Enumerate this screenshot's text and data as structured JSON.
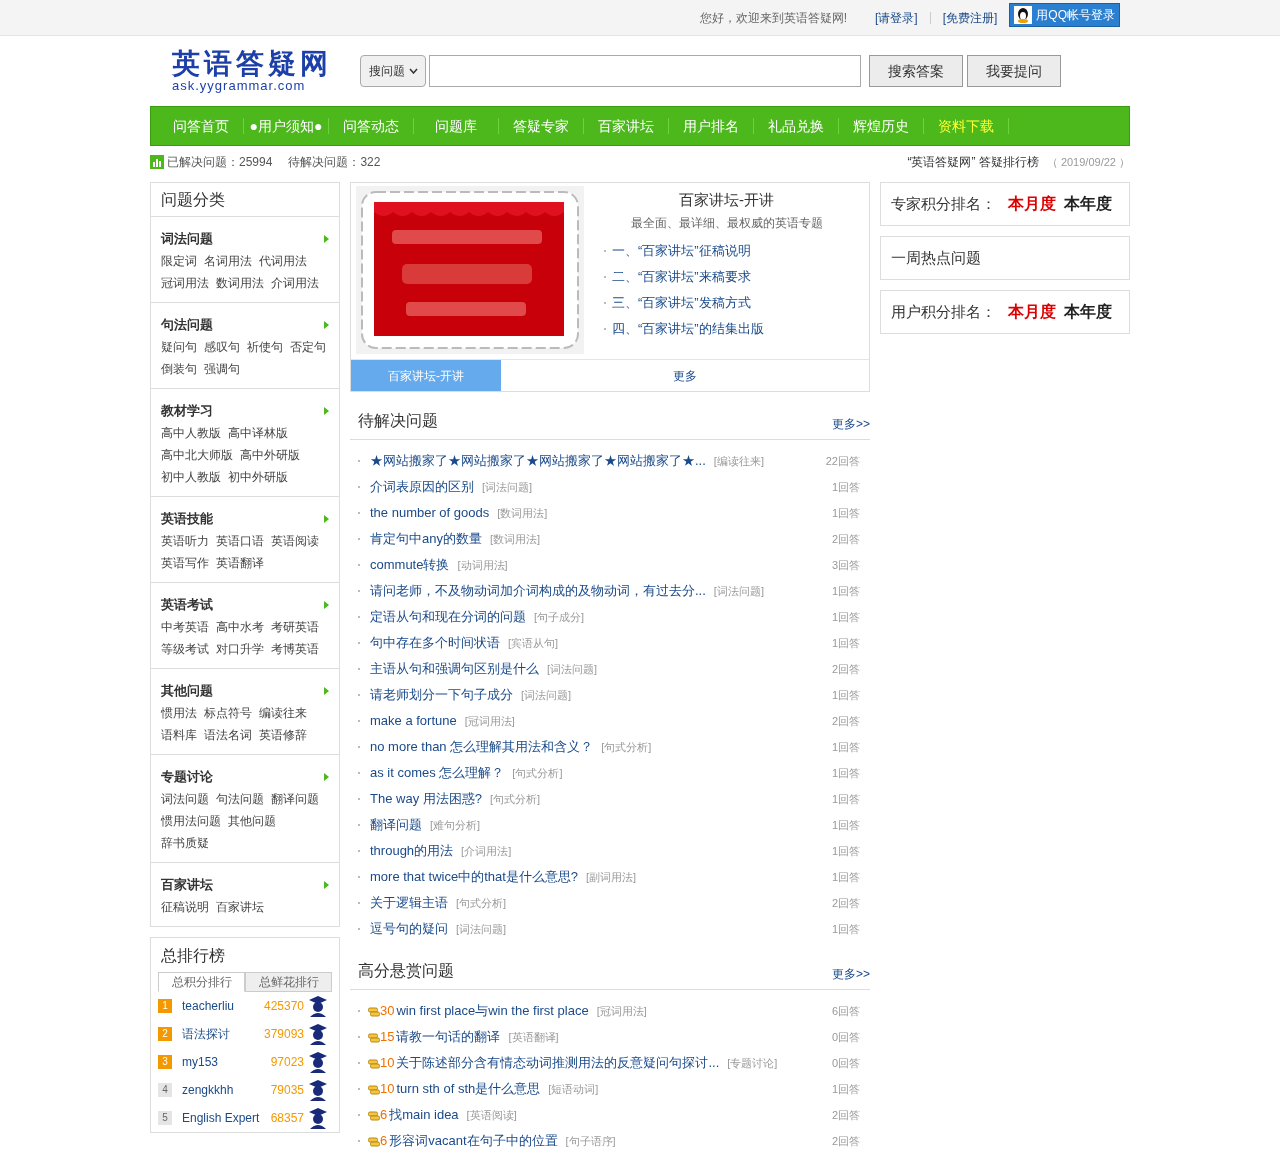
{
  "top_bar": {
    "welcome": "您好，欢迎来到英语答疑网!",
    "login": "[请登录]",
    "register": "[免费注册]",
    "qq_login": "用QQ帐号登录"
  },
  "header": {
    "logo_title": "英语答疑网",
    "logo_url": "ask.yygrammar.com",
    "search_type": "搜问题",
    "search_button": "搜索答案",
    "ask_button": "我要提问"
  },
  "nav": [
    {
      "label": "问答首页",
      "highlight": false
    },
    {
      "label": "●用户须知●",
      "highlight": false
    },
    {
      "label": "问答动态",
      "highlight": false
    },
    {
      "label": "问题库",
      "highlight": false
    },
    {
      "label": "答疑专家",
      "highlight": false
    },
    {
      "label": "百家讲坛",
      "highlight": false
    },
    {
      "label": "用户排名",
      "highlight": false
    },
    {
      "label": "礼品兑换",
      "highlight": false
    },
    {
      "label": "辉煌历史",
      "highlight": false
    },
    {
      "label": "资料下载",
      "highlight": true
    }
  ],
  "stats": {
    "solved": "已解决问题：25994",
    "pending": "待解决问题：322",
    "ranking_title": "“英语答疑网” 答疑排行榜",
    "date": "（ 2019/09/22 ）"
  },
  "categories": {
    "title": "问题分类",
    "sections": [
      {
        "heading": "词法问题",
        "rows": [
          [
            "限定词",
            "名词用法",
            "代词用法"
          ],
          [
            "冠词用法",
            "数词用法",
            "介词用法"
          ]
        ]
      },
      {
        "heading": "句法问题",
        "rows": [
          [
            "疑问句",
            "感叹句",
            "祈使句",
            "否定句"
          ],
          [
            "倒装句",
            "强调句"
          ]
        ]
      },
      {
        "heading": "教材学习",
        "rows": [
          [
            "高中人教版",
            "高中译林版"
          ],
          [
            "高中北大师版",
            "高中外研版"
          ],
          [
            "初中人教版",
            "初中外研版"
          ]
        ]
      },
      {
        "heading": "英语技能",
        "rows": [
          [
            "英语听力",
            "英语口语",
            "英语阅读"
          ],
          [
            "英语写作",
            "英语翻译"
          ]
        ]
      },
      {
        "heading": "英语考试",
        "rows": [
          [
            "中考英语",
            "高中水考",
            "考研英语"
          ],
          [
            "等级考试",
            "对口升学",
            "考博英语"
          ]
        ]
      },
      {
        "heading": "其他问题",
        "rows": [
          [
            "惯用法",
            "标点符号",
            "编读往来"
          ],
          [
            "语料库",
            "语法名词",
            "英语修辞"
          ]
        ]
      },
      {
        "heading": "专题讨论",
        "rows": [
          [
            "词法问题",
            "句法问题",
            "翻译问题"
          ],
          [
            "惯用法问题",
            "其他问题"
          ],
          [
            "辞书质疑"
          ]
        ]
      },
      {
        "heading": "百家讲坛",
        "rows": [
          [
            "征稿说明",
            "百家讲坛"
          ]
        ]
      }
    ]
  },
  "leaderboard": {
    "title": "总排行榜",
    "tabs": [
      {
        "label": "总积分排行",
        "selected": true
      },
      {
        "label": "总鲜花排行",
        "selected": false
      }
    ],
    "rows": [
      {
        "rank": "1",
        "top": true,
        "name": "teacherliu",
        "score": "425370"
      },
      {
        "rank": "2",
        "top": true,
        "name": "语法探讨",
        "score": "379093"
      },
      {
        "rank": "3",
        "top": true,
        "name": "my153",
        "score": "97023"
      },
      {
        "rank": "4",
        "top": false,
        "name": "zengkkhh",
        "score": "79035"
      },
      {
        "rank": "5",
        "top": false,
        "name": "English Expert",
        "score": "68357"
      }
    ]
  },
  "feature": {
    "title": "百家讲坛-开讲",
    "subtitle": "最全面、最详细、最权威的英语专题",
    "links": [
      "一、“百家讲坛”征稿说明",
      "二、“百家讲坛”来稿要求",
      "三、“百家讲坛”发稿方式",
      "四、“百家讲坛”的结集出版"
    ],
    "tabs": [
      {
        "label": "百家讲坛-开讲",
        "selected": true
      },
      {
        "label": "更多",
        "selected": false
      }
    ]
  },
  "pending": {
    "title": "待解决问题",
    "more": "更多>>",
    "rows": [
      {
        "title": "★网站搬家了★网站搬家了★网站搬家了★网站搬家了★...",
        "category": "[编读往来]",
        "answers": "22回答"
      },
      {
        "title": "介词表原因的区别",
        "category": "[词法问题]",
        "answers": "1回答"
      },
      {
        "title": "the number of goods",
        "category": "[数词用法]",
        "answers": "1回答"
      },
      {
        "title": "肯定句中any的数量",
        "category": "[数词用法]",
        "answers": "2回答"
      },
      {
        "title": "commute转换",
        "category": "[动词用法]",
        "answers": "3回答"
      },
      {
        "title": "请问老师，不及物动词加介词构成的及物动词，有过去分...",
        "category": "[词法问题]",
        "answers": "1回答"
      },
      {
        "title": "定语从句和现在分词的问题",
        "category": "[句子成分]",
        "answers": "1回答"
      },
      {
        "title": "句中存在多个时间状语",
        "category": "[宾语从句]",
        "answers": "1回答"
      },
      {
        "title": "主语从句和强调句区别是什么",
        "category": "[词法问题]",
        "answers": "2回答"
      },
      {
        "title": "请老师划分一下句子成分",
        "category": "[词法问题]",
        "answers": "1回答"
      },
      {
        "title": "make a fortune",
        "category": "[冠词用法]",
        "answers": "2回答"
      },
      {
        "title": "no more than 怎么理解其用法和含义？",
        "category": "[句式分析]",
        "answers": "1回答"
      },
      {
        "title": "as it comes 怎么理解？",
        "category": "[句式分析]",
        "answers": "1回答"
      },
      {
        "title": "The way 用法困惑?",
        "category": "[句式分析]",
        "answers": "1回答"
      },
      {
        "title": "翻译问题",
        "category": "[难句分析]",
        "answers": "1回答"
      },
      {
        "title": "through的用法",
        "category": "[介词用法]",
        "answers": "1回答"
      },
      {
        "title": "more that twice中的that是什么意思?",
        "category": "[副词用法]",
        "answers": "1回答"
      },
      {
        "title": "关于逻辑主语",
        "category": "[句式分析]",
        "answers": "2回答"
      },
      {
        "title": "逗号句的疑问",
        "category": "[词法问题]",
        "answers": "1回答"
      }
    ]
  },
  "bounty": {
    "title": "高分悬赏问题",
    "more": "更多>>",
    "rows": [
      {
        "points": "30",
        "title": "win first place与win the first place",
        "category": "[冠词用法]",
        "answers": "6回答"
      },
      {
        "points": "15",
        "title": "请教一句话的翻译",
        "category": "[英语翻译]",
        "answers": "0回答"
      },
      {
        "points": "10",
        "title": "关于陈述部分含有情态动词推测用法的反意疑问句探讨...",
        "category": "[专题讨论]",
        "answers": "0回答"
      },
      {
        "points": "10",
        "title": "turn sth of sth是什么意思",
        "category": "[短语动词]",
        "answers": "1回答"
      },
      {
        "points": "6",
        "title": "找main idea",
        "category": "[英语阅读]",
        "answers": "2回答"
      },
      {
        "points": "6",
        "title": "形容词vacant在句子中的位置",
        "category": "[句子语序]",
        "answers": "2回答"
      }
    ]
  },
  "right_boxes": [
    {
      "title": "专家积分排名：",
      "tabs": [
        {
          "label": "本月度",
          "selected": true
        },
        {
          "label": "本年度",
          "selected": false
        }
      ]
    },
    {
      "title": "一周热点问题"
    },
    {
      "title": "用户积分排名：",
      "tabs": [
        {
          "label": "本月度",
          "selected": true
        },
        {
          "label": "本年度",
          "selected": false
        }
      ]
    }
  ]
}
